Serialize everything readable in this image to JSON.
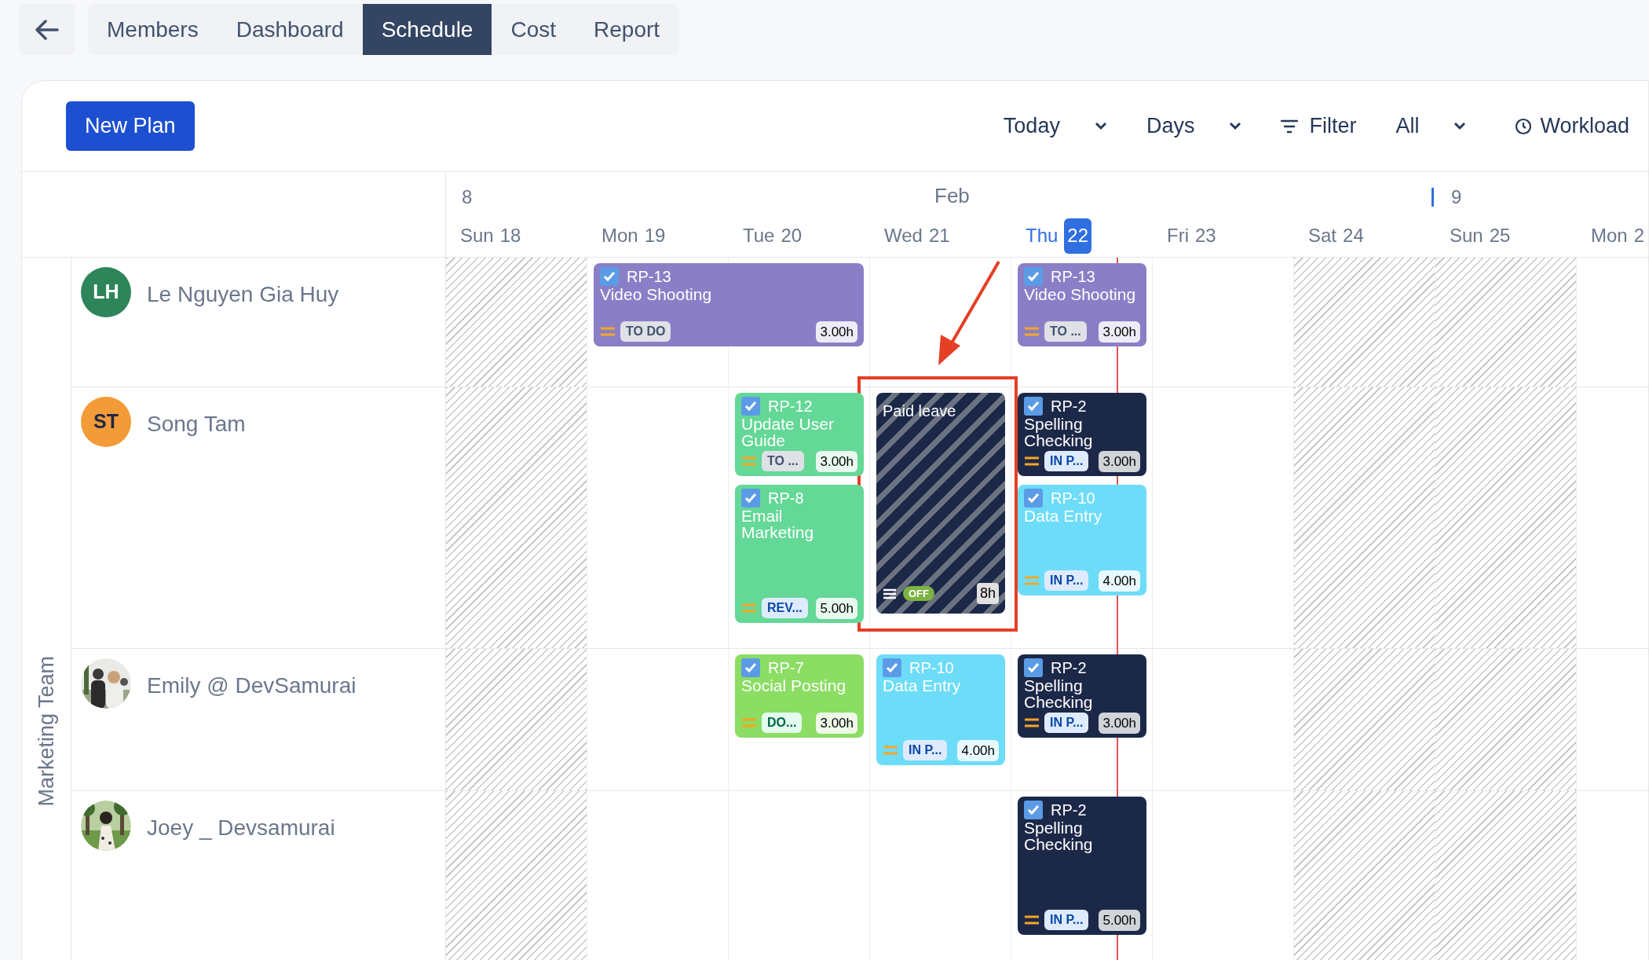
{
  "tabs": [
    {
      "label": "Members",
      "selected": false
    },
    {
      "label": "Dashboard",
      "selected": false
    },
    {
      "label": "Schedule",
      "selected": true
    },
    {
      "label": "Cost",
      "selected": false
    },
    {
      "label": "Report",
      "selected": false
    }
  ],
  "toolbar": {
    "new_plan": "New Plan",
    "controls": [
      {
        "label": "Today",
        "kind": "dropdown"
      },
      {
        "label": "Days",
        "kind": "dropdown"
      },
      {
        "label": "Filter",
        "kind": "filter"
      },
      {
        "label": "All",
        "kind": "dropdown"
      },
      {
        "label": "Workload",
        "kind": "workload"
      }
    ]
  },
  "timeline": {
    "days": [
      {
        "week": "8",
        "name": "Sun",
        "date": "18",
        "weekend": true,
        "today": false
      },
      {
        "name": "Mon",
        "date": "19",
        "weekend": false,
        "today": false
      },
      {
        "name": "Tue",
        "date": "20",
        "weekend": false,
        "today": false
      },
      {
        "month": "Feb",
        "name": "Wed",
        "date": "21",
        "weekend": false,
        "today": false
      },
      {
        "name": "Thu",
        "date": "22",
        "weekend": false,
        "today": true
      },
      {
        "name": "Fri",
        "date": "23",
        "weekend": false,
        "today": false
      },
      {
        "name": "Sat",
        "date": "24",
        "weekend": true,
        "today": false
      },
      {
        "week": "9",
        "week_marker": true,
        "name": "Sun",
        "date": "25",
        "weekend": true,
        "today": false
      },
      {
        "name": "Mon",
        "date": "2",
        "weekend": false,
        "today": false
      }
    ]
  },
  "team": {
    "name": "Marketing Team"
  },
  "members": [
    {
      "name": "Le Nguyen Gia Huy",
      "avatar": {
        "kind": "initials",
        "text": "LH",
        "color": "#2f855a"
      },
      "cards": [
        {
          "kind": "task",
          "checked": true,
          "key": "RP-13",
          "title": "Video Shooting",
          "status": {
            "label": "TO DO",
            "kind": "todo"
          },
          "hours": "3.00h",
          "color": "#8a7fc6"
        },
        {
          "kind": "task",
          "checked": true,
          "key": "RP-13",
          "title": "Video Shooting",
          "status": {
            "label": "TO ...",
            "kind": "todo"
          },
          "hours": "3.00h",
          "color": "#8a7fc6"
        }
      ]
    },
    {
      "name": "Song Tam",
      "avatar": {
        "kind": "initials",
        "text": "ST",
        "color": "#f29b38"
      },
      "cards": [
        {
          "kind": "task",
          "checked": true,
          "key": "RP-12",
          "title": "Update User Guide",
          "status": {
            "label": "TO ...",
            "kind": "todo"
          },
          "hours": "3.00h",
          "color": "#64d896"
        },
        {
          "kind": "task",
          "checked": true,
          "key": "RP-8",
          "title": "Email Marketing",
          "status": {
            "label": "REV...",
            "kind": "review"
          },
          "hours": "5.00h",
          "color": "#64d896"
        },
        {
          "kind": "leave",
          "title": "Paid leave",
          "badge": "OFF",
          "hours": "8h"
        },
        {
          "kind": "task",
          "checked": true,
          "key": "RP-2",
          "title": "Spelling Checking",
          "status": {
            "label": "IN P...",
            "kind": "progress"
          },
          "hours": "3.00h",
          "color": "#1c2848"
        },
        {
          "kind": "task",
          "checked": true,
          "key": "RP-10",
          "title": "Data Entry",
          "status": {
            "label": "IN P...",
            "kind": "progress"
          },
          "hours": "4.00h",
          "color": "#6ddcf8"
        }
      ]
    },
    {
      "name": "Emily @ DevSamurai",
      "avatar": {
        "kind": "picture"
      },
      "cards": [
        {
          "kind": "task",
          "checked": true,
          "key": "RP-7",
          "title": "Social Posting",
          "status": {
            "label": "DO...",
            "kind": "done"
          },
          "hours": "3.00h",
          "color": "#8bdd64"
        },
        {
          "kind": "task",
          "checked": true,
          "key": "RP-10",
          "title": "Data Entry",
          "status": {
            "label": "IN P...",
            "kind": "progress"
          },
          "hours": "4.00h",
          "color": "#6ddcf8"
        },
        {
          "kind": "task",
          "checked": true,
          "key": "RP-2",
          "title": "Spelling Checking",
          "status": {
            "label": "IN P...",
            "kind": "progress"
          },
          "hours": "3.00h",
          "color": "#1c2848"
        }
      ]
    },
    {
      "name": "Joey _ Devsamurai",
      "avatar": {
        "kind": "picture"
      },
      "cards": [
        {
          "kind": "task",
          "checked": true,
          "key": "RP-2",
          "title": "Spelling Checking",
          "status": {
            "label": "IN P...",
            "kind": "progress"
          },
          "hours": "5.00h",
          "color": "#1c2848"
        }
      ]
    }
  ]
}
